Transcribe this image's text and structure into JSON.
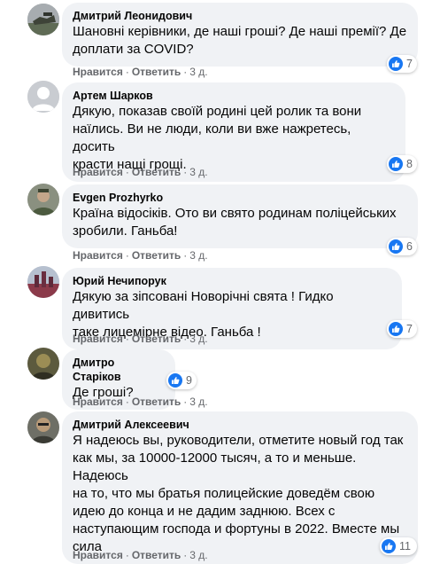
{
  "colors": {
    "bubble": "#f0f2f5",
    "like_blue": "#1877f2",
    "meta_gray": "#65676b",
    "text": "#050505"
  },
  "comments": [
    {
      "author": "Дмитрий Леонидович",
      "lines": [
        "Шановні керівники, де наші гроші? Де наші премії? Де",
        "доплати за COVID?"
      ],
      "like_label": "Нравится",
      "reply_label": "Ответить",
      "time": "3 д.",
      "reactions": "7",
      "reaction_icon": "thumbs-up-icon"
    },
    {
      "author": "Артем Шарков",
      "lines": [
        "Дякую, показав своїй родині цей ролик та вони",
        "наїлись. Ви не люди, коли ви вже нажретесь, досить",
        "красти нащі грощі."
      ],
      "like_label": "Нравится",
      "reply_label": "Ответить",
      "time": "3 д.",
      "reactions": "8",
      "reaction_icon": "thumbs-up-icon"
    },
    {
      "author": "Evgen Prozhyrko",
      "lines": [
        "Країна відосіків. Ото ви свято родинам поліцейських",
        "зробили. Ганьба!"
      ],
      "like_label": "Нравится",
      "reply_label": "Ответить",
      "time": "3 д.",
      "reactions": "6",
      "reaction_icon": "thumbs-up-icon"
    },
    {
      "author": "Юрий Нечипорук",
      "lines": [
        "Дякую за зіпсовані Новорічні свята ! Гидко дивитись",
        "таке лицемірне відео. Ганьба !"
      ],
      "like_label": "Нравится",
      "reply_label": "Ответить",
      "time": "3 д.",
      "reactions": "7",
      "reaction_icon": "thumbs-up-icon"
    },
    {
      "author": "Дмитро Старіков",
      "lines": [
        "Де гроші?"
      ],
      "like_label": "Нравится",
      "reply_label": "Ответить",
      "time": "3 д.",
      "reactions": "9",
      "reaction_icon": "thumbs-up-icon"
    },
    {
      "author": "Дмитрий Алексеевич",
      "lines": [
        "Я надеюсь вы, руководители, отметите новый год так",
        "как мы, за 10000-12000 тысяч, а то и меньше. Надеюсь",
        "на то, что мы братья полицейские доведём свою",
        "идею до конца и не дадим заднюю. Всех с",
        "наступающим господа и фортуны в 2022. Вместе мы",
        "сила"
      ],
      "like_label": "Нравится",
      "reply_label": "Ответить",
      "time": "3 д.",
      "reactions": "11",
      "reaction_icon": "thumbs-up-icon"
    }
  ]
}
